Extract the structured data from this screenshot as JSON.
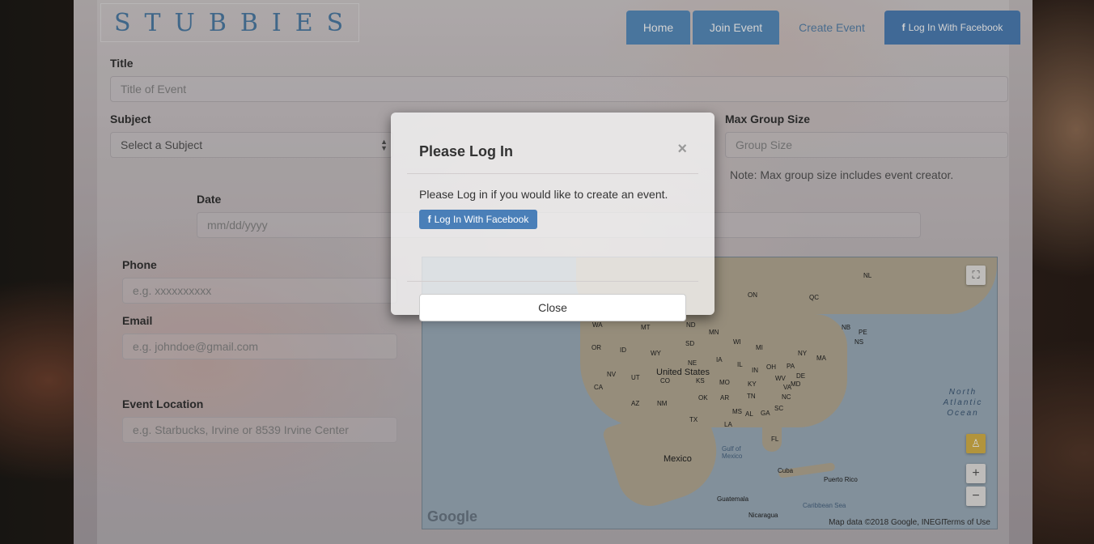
{
  "header": {
    "logo_text": "STUBBIES",
    "nav": {
      "home": "Home",
      "join": "Join Event",
      "create": "Create Event",
      "facebook": "Log In With Facebook"
    }
  },
  "form": {
    "title_label": "Title",
    "title_placeholder": "Title of Event",
    "subject_label": "Subject",
    "subject_value": "Select a Subject",
    "max_group_label": "Max Group Size",
    "max_group_placeholder": "Group Size",
    "max_group_note": "Note: Max group size includes event creator.",
    "date_label": "Date",
    "date_placeholder": "mm/dd/yyyy",
    "phone_label": "Phone",
    "phone_placeholder": "e.g. xxxxxxxxxx",
    "email_label": "Email",
    "email_placeholder": "e.g. johndoe@gmail.com",
    "location_label": "Event Location",
    "location_placeholder": "e.g. Starbucks, Irvine or 8539 Irvine Center"
  },
  "map": {
    "labels": {
      "nl": "NL",
      "on": "ON",
      "qc": "QC",
      "nb": "NB",
      "pe": "PE",
      "ns": "NS",
      "wa": "WA",
      "mt": "MT",
      "nd": "ND",
      "mn": "MN",
      "or": "OR",
      "id": "ID",
      "sd": "SD",
      "wy": "WY",
      "wi": "WI",
      "mi": "MI",
      "ny": "NY",
      "ma": "MA",
      "ia": "IA",
      "ne": "NE",
      "nv": "NV",
      "ut": "UT",
      "co": "CO",
      "il": "IL",
      "in": "IN",
      "oh": "OH",
      "pa": "PA",
      "de": "DE",
      "md": "MD",
      "ks": "KS",
      "mo": "MO",
      "wv": "WV",
      "va": "VA",
      "ca": "CA",
      "ky": "KY",
      "az": "AZ",
      "nm": "NM",
      "ok": "OK",
      "ar": "AR",
      "tn": "TN",
      "nc": "NC",
      "sc": "SC",
      "ms": "MS",
      "al": "AL",
      "ga": "GA",
      "tx": "TX",
      "la": "LA",
      "fl": "FL",
      "us": "United States",
      "mexico": "Mexico",
      "gulf": "Gulf of Mexico",
      "cuba": "Cuba",
      "puerto_rico": "Puerto Rico",
      "caribbean": "Caribbean Sea",
      "guatemala": "Guatemala",
      "nicaragua": "Nicaragua",
      "ocean": "North Atlantic Ocean"
    },
    "google": "Google",
    "data_credit": "Map data ©2018 Google, INEGI",
    "terms": "Terms of Use",
    "zoom_in": "+",
    "zoom_out": "−"
  },
  "modal": {
    "title": "Please Log In",
    "close_x": "×",
    "body": "Please Log in if you would like to create an event.",
    "facebook_button": "Log In With Facebook",
    "close_button": "Close"
  }
}
